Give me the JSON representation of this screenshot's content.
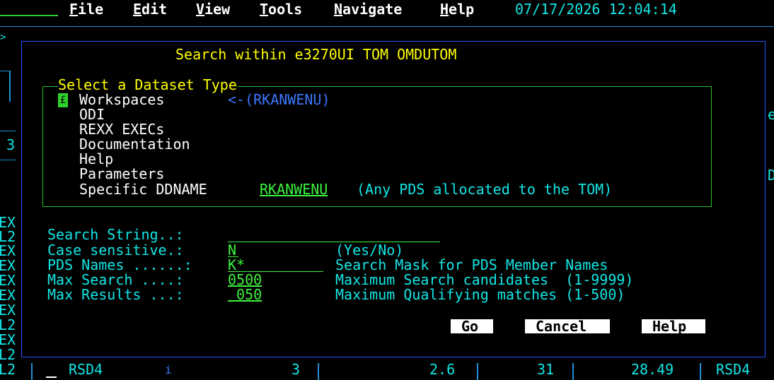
{
  "menubar": {
    "items": [
      {
        "label": "File",
        "key": "F",
        "rest": "ile"
      },
      {
        "label": "Edit",
        "key": "E",
        "rest": "dit"
      },
      {
        "label": "View",
        "key": "V",
        "rest": "iew"
      },
      {
        "label": "Tools",
        "key": "T",
        "rest": "ools"
      },
      {
        "label": "Navigate",
        "key": "N",
        "rest": "avigate"
      },
      {
        "label": "Help",
        "key": "H",
        "rest": "elp"
      }
    ],
    "datetime": "07/17/2026 12:04:14"
  },
  "dialog": {
    "title": "Search within e3270UI TOM OMDUTOM",
    "group_title": "Select a Dataset Type",
    "selection_marker": "£",
    "dataset_types": [
      "Workspaces",
      "ODI",
      "REXX EXECs",
      "Documentation",
      "Help",
      "Parameters",
      "Specific DDNAME"
    ],
    "workspaces_hint": "<-(RKANWENU)",
    "ddname_value": "RKANWENU",
    "ddname_hint": "(Any PDS allocated to the TOM)",
    "fields": {
      "search_string": {
        "label": "Search String..:",
        "value": ""
      },
      "case_sensitive": {
        "label": "Case sensitive.:",
        "value": "N",
        "hint": "(Yes/No)"
      },
      "pds_names": {
        "label": "PDS Names ......:",
        "value": "K*",
        "hint": "Search Mask for PDS Member Names"
      },
      "max_search": {
        "label": "Max Search ....:",
        "value": "0500",
        "hint": "Maximum Search candidates  (1-9999)"
      },
      "max_results": {
        "label": "Max Results ...:",
        "value": " 050",
        "hint": "Maximum Qualifying matches (1-500)"
      }
    },
    "buttons": {
      "go": "Go",
      "cancel": "Cancel",
      "help": "Help"
    }
  },
  "background": {
    "left_fragments": [
      ">",
      "3",
      "EX",
      "L2",
      "EX",
      "EX",
      "EX",
      "EX",
      "EX",
      "L2",
      "EX",
      "L2",
      "L2"
    ],
    "right_fragments": [
      "e",
      "D"
    ]
  },
  "statusbar": {
    "system": "RSD4",
    "marker": "i",
    "count": "3",
    "val1": "2.6",
    "val2": "31",
    "val3": "28.49",
    "system2": "RSD4"
  }
}
